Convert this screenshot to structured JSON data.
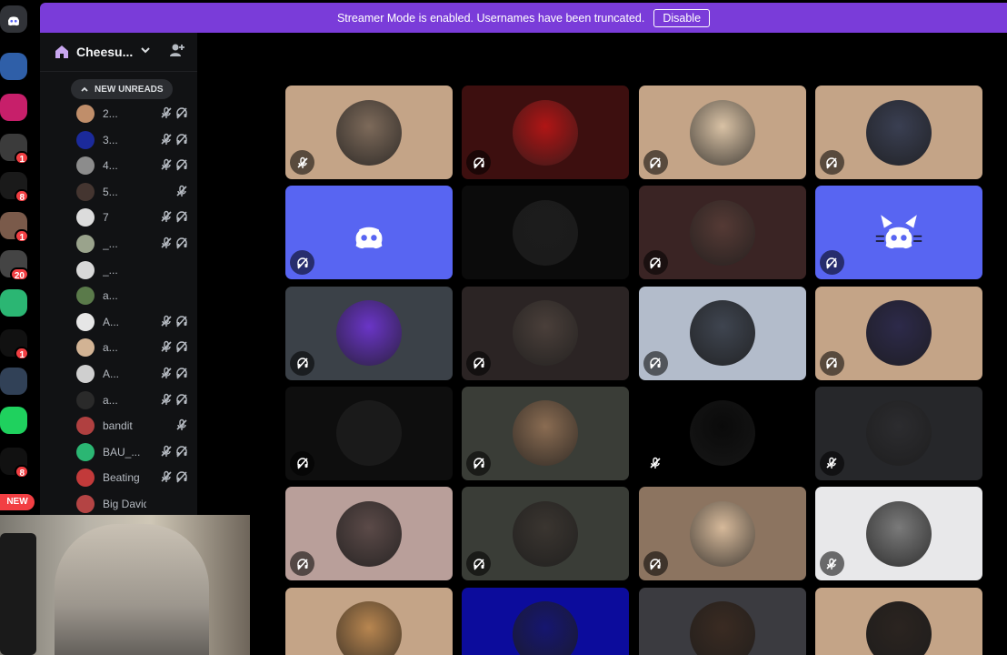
{
  "banner": {
    "text": "Streamer Mode is enabled. Usernames have been truncated.",
    "button": "Disable",
    "color": "#7a3cd9"
  },
  "rail": {
    "items": [
      {
        "icon": "discord-logo",
        "badge": ""
      },
      {
        "icon": "server-santa",
        "badge": ""
      },
      {
        "icon": "server-lips",
        "badge": ""
      },
      {
        "icon": "server-car",
        "badge": "1"
      },
      {
        "icon": "server-cooldraws",
        "badge": "8"
      },
      {
        "icon": "server-portrait",
        "badge": "1"
      },
      {
        "icon": "server-group",
        "badge": "20"
      },
      {
        "icon": "server-gift",
        "badge": ""
      },
      {
        "icon": "server-blaze",
        "badge": "1"
      },
      {
        "icon": "server-person",
        "badge": ""
      },
      {
        "icon": "server-kick",
        "badge": ""
      },
      {
        "icon": "server-srt",
        "badge": "8"
      }
    ],
    "new_label": "NEW"
  },
  "sidebar": {
    "server_name": "Cheesu...",
    "new_unreads": "NEW UNREADS",
    "members": [
      {
        "name": "2...",
        "mic_off": true,
        "deaf": true
      },
      {
        "name": "3...",
        "mic_off": true,
        "deaf": true
      },
      {
        "name": "4...",
        "mic_off": true,
        "deaf": true
      },
      {
        "name": "5...",
        "mic_off": true,
        "deaf": false
      },
      {
        "name": "7",
        "mic_off": true,
        "deaf": true
      },
      {
        "name": "_...",
        "mic_off": true,
        "deaf": true
      },
      {
        "name": "_...",
        "mic_off": false,
        "deaf": false
      },
      {
        "name": "a...",
        "mic_off": false,
        "deaf": false
      },
      {
        "name": "A...",
        "mic_off": true,
        "deaf": true
      },
      {
        "name": "a...",
        "mic_off": true,
        "deaf": true
      },
      {
        "name": "A...",
        "mic_off": true,
        "deaf": true
      },
      {
        "name": "a...",
        "mic_off": true,
        "deaf": true
      },
      {
        "name": "bandit",
        "mic_off": true,
        "deaf": false
      },
      {
        "name": "BAU_...",
        "mic_off": true,
        "deaf": true
      },
      {
        "name": "Beating",
        "mic_off": true,
        "deaf": true
      },
      {
        "name": "Big David",
        "mic_off": false,
        "deaf": false
      }
    ]
  },
  "tiles": [
    {
      "bg": "#c4a487",
      "pfp": "#7d6a5a",
      "status": "mic-off"
    },
    {
      "bg": "#3d0f0f",
      "pfp": "#b01515",
      "status": "deafened"
    },
    {
      "bg": "#c4a487",
      "pfp": "#d9c2a5",
      "status": "deafened"
    },
    {
      "bg": "#c4a487",
      "pfp": "#3a3f52",
      "status": "deafened"
    },
    {
      "bg": "#5865f2",
      "pfp": "discord",
      "status": "deafened"
    },
    {
      "bg": "#0b0b0b",
      "pfp": "#1c1c1c",
      "status": ""
    },
    {
      "bg": "#3a2424",
      "pfp": "#553a35",
      "status": "deafened"
    },
    {
      "bg": "#5865f2",
      "pfp": "discord-cat",
      "status": "deafened"
    },
    {
      "bg": "#3b4148",
      "pfp": "#6a35c7",
      "status": "deafened"
    },
    {
      "bg": "#2b2424",
      "pfp": "#4a3f3a",
      "status": "deafened"
    },
    {
      "bg": "#b3bccb",
      "pfp": "#3f4550",
      "status": "deafened"
    },
    {
      "bg": "#c4a487",
      "pfp": "#2d2a4a",
      "status": "deafened"
    },
    {
      "bg": "#0e0e0e",
      "pfp": "#1a1a1a",
      "status": "deafened"
    },
    {
      "bg": "#3a3d37",
      "pfp": "#8a6c52",
      "status": "deafened"
    },
    {
      "bg": "#000000",
      "pfp": "#0a0a0a",
      "status": "mic-off"
    },
    {
      "bg": "#26272a",
      "pfp": "#2c2c2f",
      "status": "mic-off"
    },
    {
      "bg": "#b99f9a",
      "pfp": "#5b4a48",
      "status": "deafened"
    },
    {
      "bg": "#3a3d37",
      "pfp": "#3a3530",
      "status": "deafened"
    },
    {
      "bg": "#8c7460",
      "pfp": "#d6b99a",
      "status": "deafened"
    },
    {
      "bg": "#e8e8ea",
      "pfp": "#7a7a7a",
      "status": "mic-off"
    },
    {
      "bg": "#c4a487",
      "pfp": "#b88650",
      "status": ""
    },
    {
      "bg": "#0c0c9c",
      "pfp": "#161670",
      "status": ""
    },
    {
      "bg": "#3b3b40",
      "pfp": "#3a2b22",
      "status": ""
    },
    {
      "bg": "#c4a487",
      "pfp": "#2b2420",
      "status": ""
    }
  ]
}
